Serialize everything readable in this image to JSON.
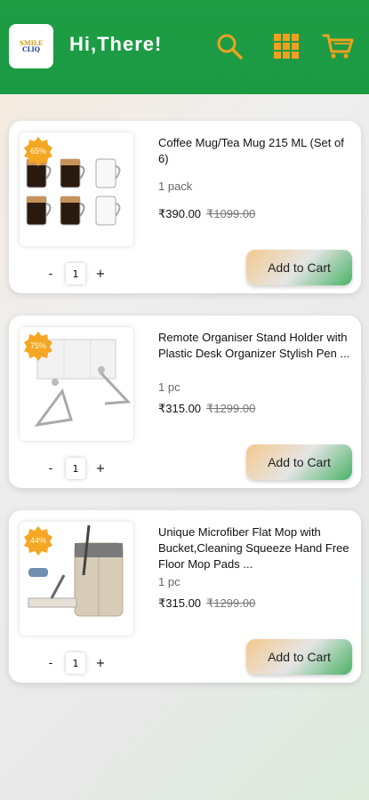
{
  "header": {
    "logo_line1": "SMILE",
    "logo_line2": "CLIQ",
    "greeting": "Hi,There!",
    "icons": [
      "search-icon",
      "grid-icon",
      "cart-icon"
    ],
    "accent_color": "#1a9a43",
    "icon_color": "#f0a020"
  },
  "products": [
    {
      "discount": "65%",
      "title": "Coffee Mug/Tea Mug 215 ML (Set of 6)",
      "unit": "1 pack",
      "price": "₹390.00",
      "mrp": "₹1099.00",
      "quantity": "1",
      "minus": "-",
      "plus": "+",
      "add_label": "Add to Cart"
    },
    {
      "discount": "75%",
      "title": "Remote Organiser Stand Holder with Plastic Desk Organizer Stylish Pen ...",
      "unit": "1 pc",
      "price": "₹315.00",
      "mrp": "₹1299.00",
      "quantity": "1",
      "minus": "-",
      "plus": "+",
      "add_label": "Add to Cart"
    },
    {
      "discount": "44%",
      "title": "Unique Microfiber Flat Mop with Bucket,Cleaning Squeeze Hand Free Floor Mop Pads ...",
      "unit": "1 pc",
      "price": "₹315.00",
      "mrp": "₹1299.00",
      "quantity": "1",
      "minus": "-",
      "plus": "+",
      "add_label": "Add to Cart"
    }
  ]
}
